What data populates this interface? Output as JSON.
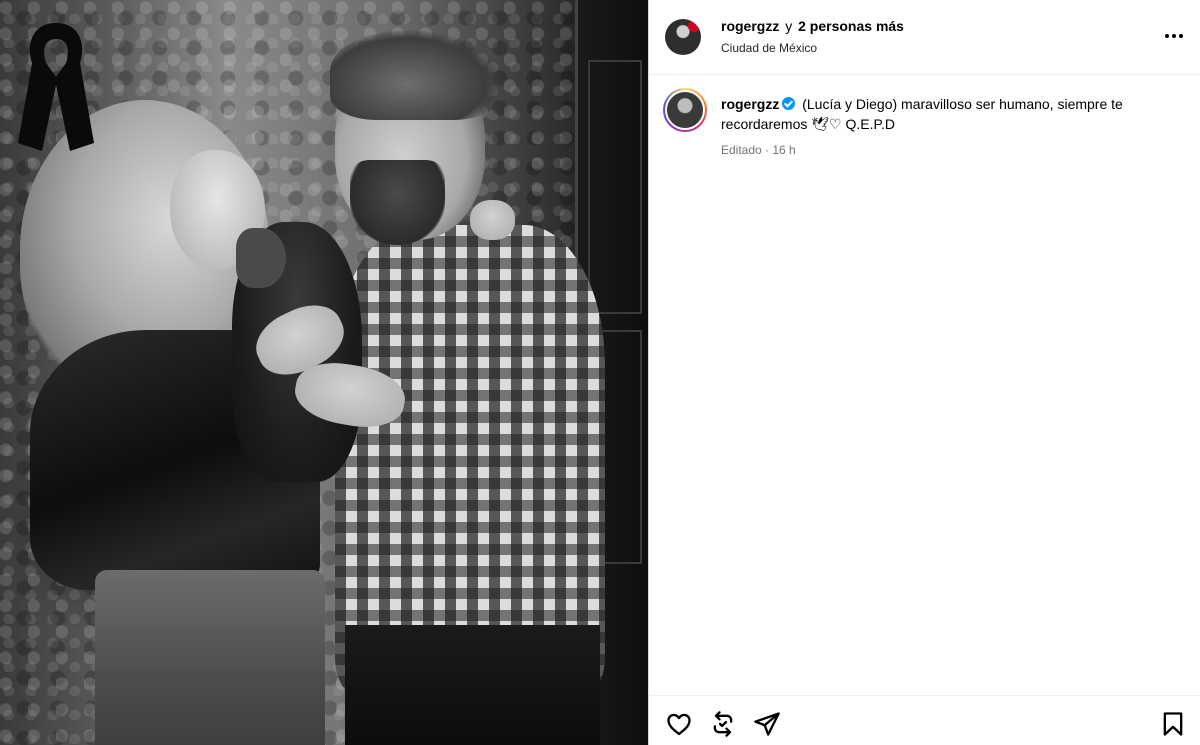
{
  "header": {
    "username": "rogergzz",
    "conjunction": "y",
    "others": "2 personas más",
    "location": "Ciudad de México"
  },
  "caption": {
    "username": "rogergzz",
    "verified": true,
    "text": "(Lucía y Diego) maravilloso ser humano, siempre te recordaremos",
    "emoji": "🕊♡",
    "suffix": "Q.E.P.D",
    "meta": "Editado · 16 h"
  },
  "photo": {
    "overlay": "black-mourning-ribbon-icon",
    "style": "black-and-white"
  },
  "icons": {
    "more": "more-options-icon",
    "like": "heart-icon",
    "repost": "repost-icon",
    "share": "paper-plane-icon",
    "save": "bookmark-icon"
  },
  "colors": {
    "verified": "#0095f6",
    "meta_text": "#737373",
    "divider": "#efefef",
    "story_ring": [
      "#feda75",
      "#fa7e1e",
      "#d62976",
      "#962fbf",
      "#4f5bd5"
    ]
  }
}
